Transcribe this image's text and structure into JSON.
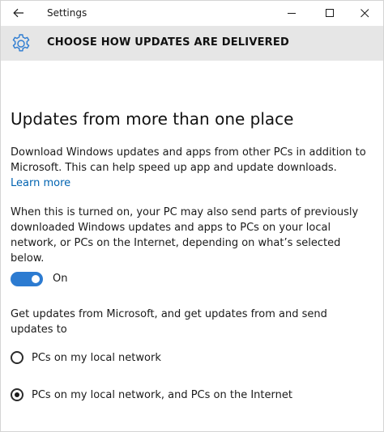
{
  "window": {
    "app_title": "Settings"
  },
  "header": {
    "title": "CHOOSE HOW UPDATES ARE DELIVERED",
    "icon": "gear-icon"
  },
  "main": {
    "heading": "Updates from more than one place",
    "description": "Download Windows updates and apps from other PCs in addition to Microsoft. This can help speed up app and update downloads.",
    "learn_more": "Learn more",
    "warning": "When this is turned on, your PC may also send parts of previously downloaded Windows updates and apps to PCs on your local network, or PCs on the Internet, depending on what’s selected below.",
    "toggle": {
      "state": true,
      "label": "On"
    },
    "source_prompt": "Get updates from Microsoft, and get updates from and send updates to",
    "options": [
      {
        "label": "PCs on my local network",
        "selected": false
      },
      {
        "label": "PCs on my local network, and PCs on the Internet",
        "selected": true
      }
    ]
  },
  "colors": {
    "accent": "#2c7bd1",
    "link": "#0063b1",
    "header_band": "#e6e6e6"
  }
}
